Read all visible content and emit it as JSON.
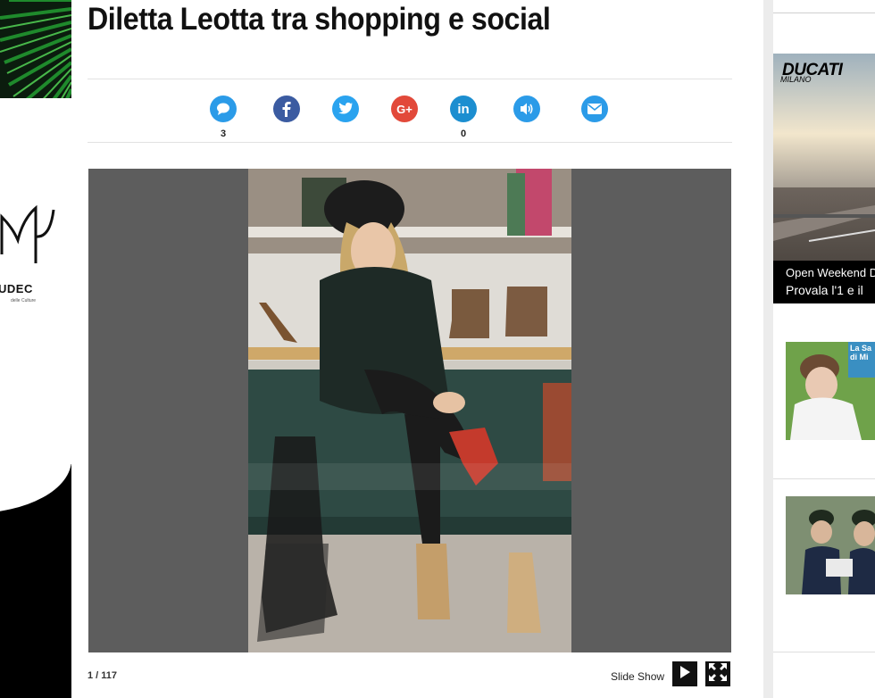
{
  "article": {
    "title": "Diletta Leotta tra shopping e social"
  },
  "share_bar": {
    "buttons": [
      {
        "name": "comment",
        "icon": "comment-icon",
        "color": "#2b9be8",
        "count": "3"
      },
      {
        "name": "facebook",
        "icon": "facebook-icon",
        "color": "#3b5ba1",
        "count": ""
      },
      {
        "name": "twitter",
        "icon": "twitter-icon",
        "color": "#2aa3ef",
        "count": ""
      },
      {
        "name": "google-plus",
        "icon": "google-plus-icon",
        "color": "#e2493a",
        "count": ""
      },
      {
        "name": "linkedin",
        "icon": "linkedin-icon",
        "color": "#1c8ed0",
        "count": "0"
      },
      {
        "name": "audio",
        "icon": "speaker-icon",
        "color": "#2b9be8",
        "count": ""
      },
      {
        "name": "email",
        "icon": "mail-icon",
        "color": "#2b9be8",
        "count": ""
      }
    ]
  },
  "gallery": {
    "counter": "1 / 117",
    "slideshow_label": "Slide Show",
    "play_icon": "play-icon",
    "fullscreen_icon": "fullscreen-icon"
  },
  "left_ad": {
    "logo_text": "UDEC",
    "sub_text": "delle Culture"
  },
  "right_ads": {
    "ducati": {
      "brand": "DUCATI",
      "city": "MILANO",
      "line1": "Open Weekend D",
      "line2": "Provala l'1 e il"
    },
    "news1_badge": "La Sa di Mi"
  },
  "colors": {
    "gallery_bg": "#5d5d5d",
    "page_bg": "#ececec"
  }
}
